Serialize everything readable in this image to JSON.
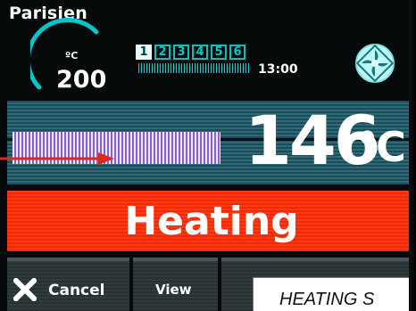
{
  "program": {
    "name": "Parisien"
  },
  "setpoint": {
    "unit": "ºC",
    "value": "200"
  },
  "steps": {
    "items": [
      "1",
      "2",
      "3",
      "4",
      "5",
      "6"
    ],
    "active_index": 0
  },
  "time": {
    "label": "13:00"
  },
  "fan": {
    "icon": "fan-icon"
  },
  "temperature": {
    "current": "146",
    "unit": "°C"
  },
  "status": {
    "text": "Heating",
    "color": "#f0290a"
  },
  "softkeys": {
    "cancel_label": "Cancel",
    "view_label": "View",
    "cancel_icon": "close-icon"
  },
  "caption": {
    "text": "HEATING S"
  },
  "colors": {
    "accent": "#00c2c2",
    "bar": "#7b55c8",
    "arrow": "#e0281a"
  }
}
